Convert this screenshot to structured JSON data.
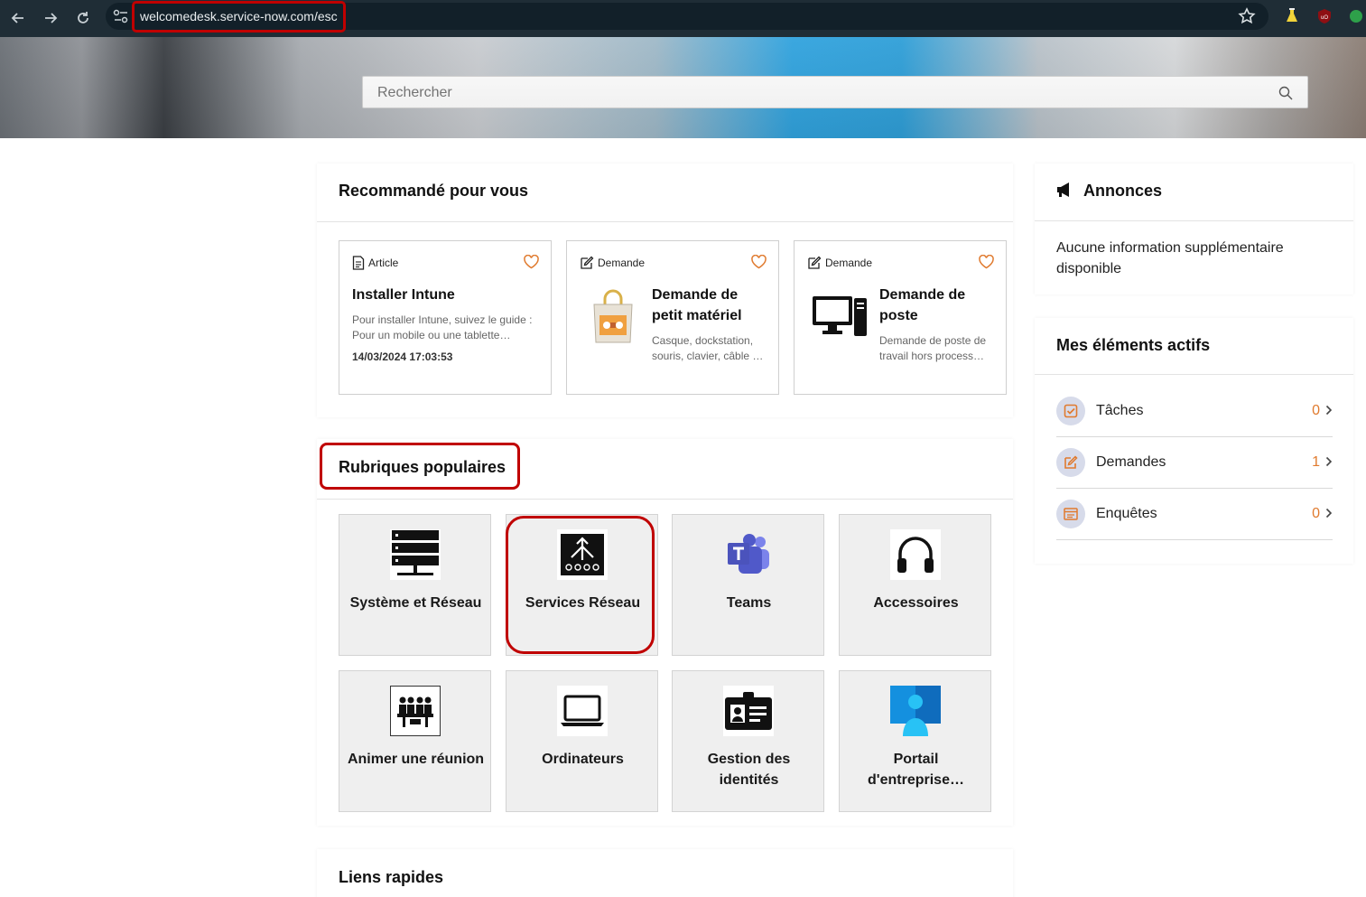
{
  "browser": {
    "url": "welcomedesk.service-now.com/esc",
    "icons": [
      "back-icon",
      "forward-icon",
      "reload-icon",
      "site-info-icon",
      "bookmark-star-icon"
    ]
  },
  "search": {
    "placeholder": "Rechercher"
  },
  "recommended": {
    "title": "Recommandé pour vous",
    "cards": [
      {
        "type": "Article",
        "title": "Installer Intune",
        "desc": "Pour installer Intune, suivez le guide : Pour un mobile ou une tablette…",
        "date": "14/03/2024 17:03:53"
      },
      {
        "type": "Demande",
        "title": "Demande de petit matériel",
        "desc": "Casque, dockstation, souris, clavier, câble …"
      },
      {
        "type": "Demande",
        "title": "Demande de poste",
        "desc": "Demande de poste de travail hors process…"
      }
    ]
  },
  "popular": {
    "title": "Rubriques populaires",
    "tiles": [
      {
        "label": "Système et Réseau",
        "icon": "server-rack-icon"
      },
      {
        "label": "Services Réseau",
        "icon": "network-tree-icon"
      },
      {
        "label": "Teams",
        "icon": "teams-icon"
      },
      {
        "label": "Accessoires",
        "icon": "headphones-icon"
      },
      {
        "label": "Animer une réunion",
        "icon": "meeting-icon"
      },
      {
        "label": "Ordinateurs",
        "icon": "laptop-icon"
      },
      {
        "label": "Gestion des identités",
        "icon": "id-card-icon"
      },
      {
        "label": "Portail d'entreprise…",
        "icon": "company-portal-icon"
      }
    ]
  },
  "quick_links": {
    "title": "Liens rapides"
  },
  "announcements": {
    "title": "Annonces",
    "body": "Aucune information supplémentaire disponible"
  },
  "active": {
    "title": "Mes éléments actifs",
    "items": [
      {
        "label": "Tâches",
        "count": "0"
      },
      {
        "label": "Demandes",
        "count": "1"
      },
      {
        "label": "Enquêtes",
        "count": "0"
      }
    ]
  },
  "colors": {
    "accent": "#e07a2e",
    "highlight": "#c00000",
    "browser_bar": "#1f2d36"
  }
}
